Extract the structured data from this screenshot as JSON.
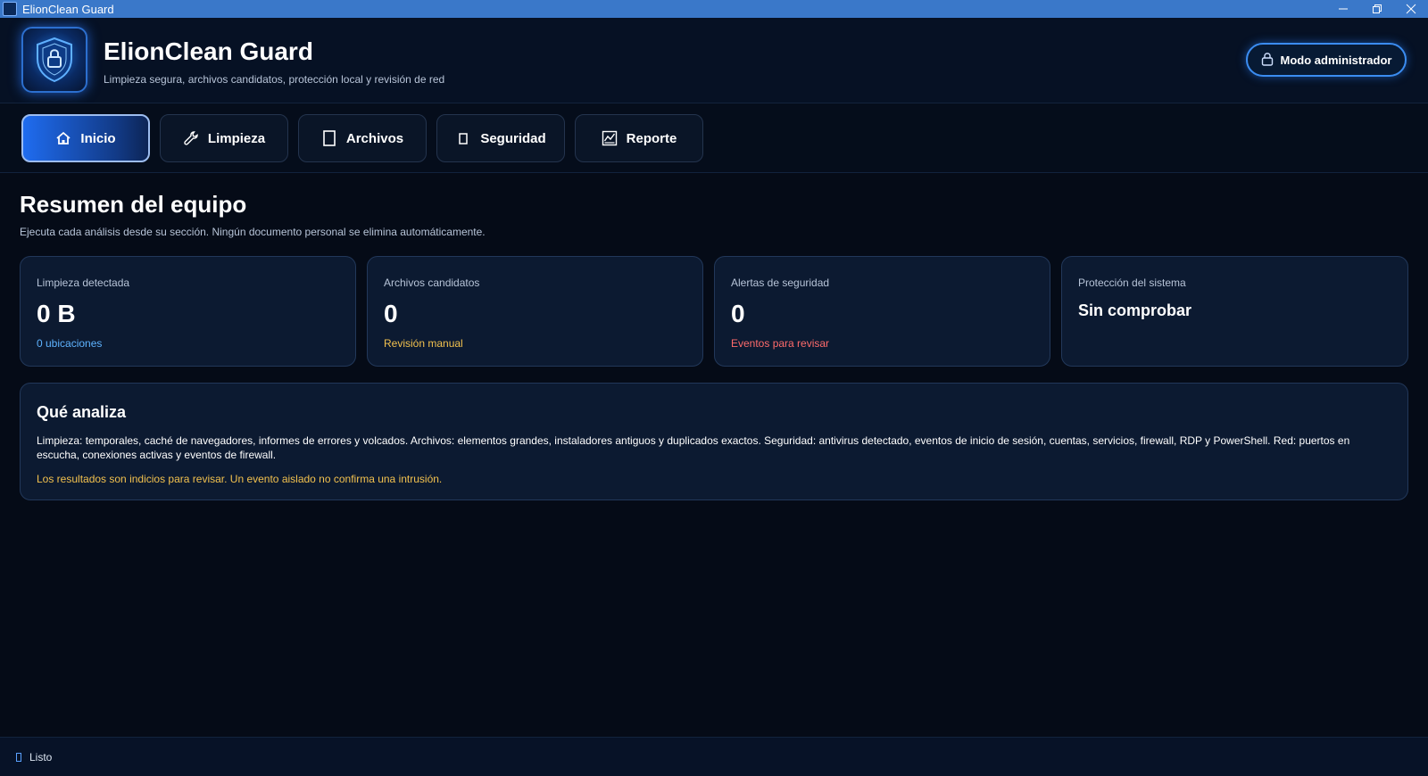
{
  "window": {
    "title": "ElionClean Guard",
    "controls": [
      "minimize-icon",
      "restore-icon",
      "close-icon"
    ]
  },
  "header": {
    "app_name": "ElionClean Guard",
    "subtitle": "Limpieza segura, archivos candidatos, protección local y revisión de red",
    "admin_button": "Modo administrador",
    "logo_icon": "shield-lock-icon"
  },
  "tabs": [
    {
      "label": "Inicio",
      "icon": "home-icon",
      "active": true
    },
    {
      "label": "Limpieza",
      "icon": "wrench-icon",
      "active": false
    },
    {
      "label": "Archivos",
      "icon": "document-icon",
      "active": false
    },
    {
      "label": "Seguridad",
      "icon": "shield-icon",
      "active": false
    },
    {
      "label": "Reporte",
      "icon": "chart-icon",
      "active": false
    }
  ],
  "main": {
    "title": "Resumen del equipo",
    "description": "Ejecuta cada análisis desde su sección. Ningún documento personal se elimina automáticamente.",
    "cards": [
      {
        "label": "Limpieza detectada",
        "value": "0 B",
        "sub": "0 ubicaciones",
        "sub_color": "#5eb3ff"
      },
      {
        "label": "Archivos candidatos",
        "value": "0",
        "sub": "Revisión manual",
        "sub_color": "#f2c14e"
      },
      {
        "label": "Alertas de seguridad",
        "value": "0",
        "sub": "Eventos para revisar",
        "sub_color": "#ff6b6b"
      },
      {
        "label": "Protección del sistema",
        "value": "Sin comprobar"
      }
    ],
    "info": {
      "heading": "Qué analiza",
      "body": "Limpieza: temporales, caché de navegadores, informes de errores y volcados. Archivos: elementos grandes, instaladores antiguos y duplicados exactos. Seguridad: antivirus detectado, eventos de inicio de sesión, cuentas, servicios, firewall, RDP y PowerShell. Red: puertos en escucha, conexiones activas y eventos de firewall.",
      "note": "Los resultados son indicios para revisar. Un evento aislado no confirma una intrusión."
    }
  },
  "status": {
    "text": "Listo"
  },
  "colors": {
    "accent": "#1f6cf0",
    "background": "#050b17",
    "card": "#0c1a31",
    "warning": "#f2c14e",
    "danger": "#ff6b6b",
    "info": "#5eb3ff"
  }
}
